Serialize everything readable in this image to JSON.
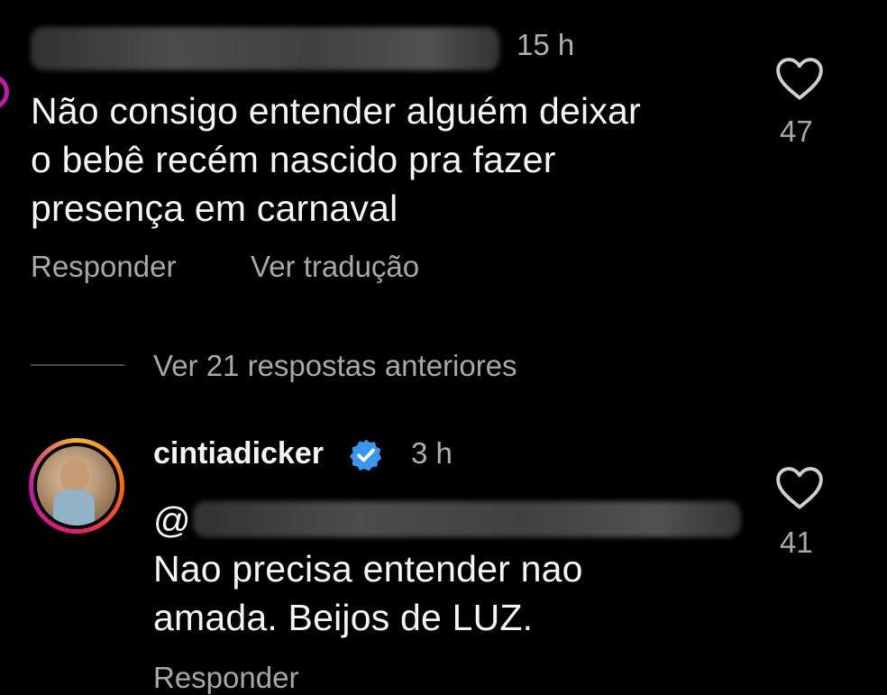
{
  "comment1": {
    "time": "15 h",
    "text_lines": [
      "Não consigo entender alguém deixar",
      "o bebê recém nascido pra fazer",
      "presença em carnaval"
    ],
    "reply_label": "Responder",
    "translate_label": "Ver tradução",
    "like_count": "47"
  },
  "thread": {
    "view_previous_label": "Ver 21 respostas anteriores"
  },
  "comment2": {
    "username": "cintiadicker",
    "time": "3 h",
    "mention_prefix": "@",
    "text_lines": [
      "Nao precisa entender nao",
      "amada. Beijos de LUZ."
    ],
    "reply_label": "Responder",
    "like_count": "41"
  },
  "colors": {
    "background": "#000000",
    "text": "#f4f4f4",
    "muted": "#a8a8a8",
    "verified": "#3897f0"
  }
}
